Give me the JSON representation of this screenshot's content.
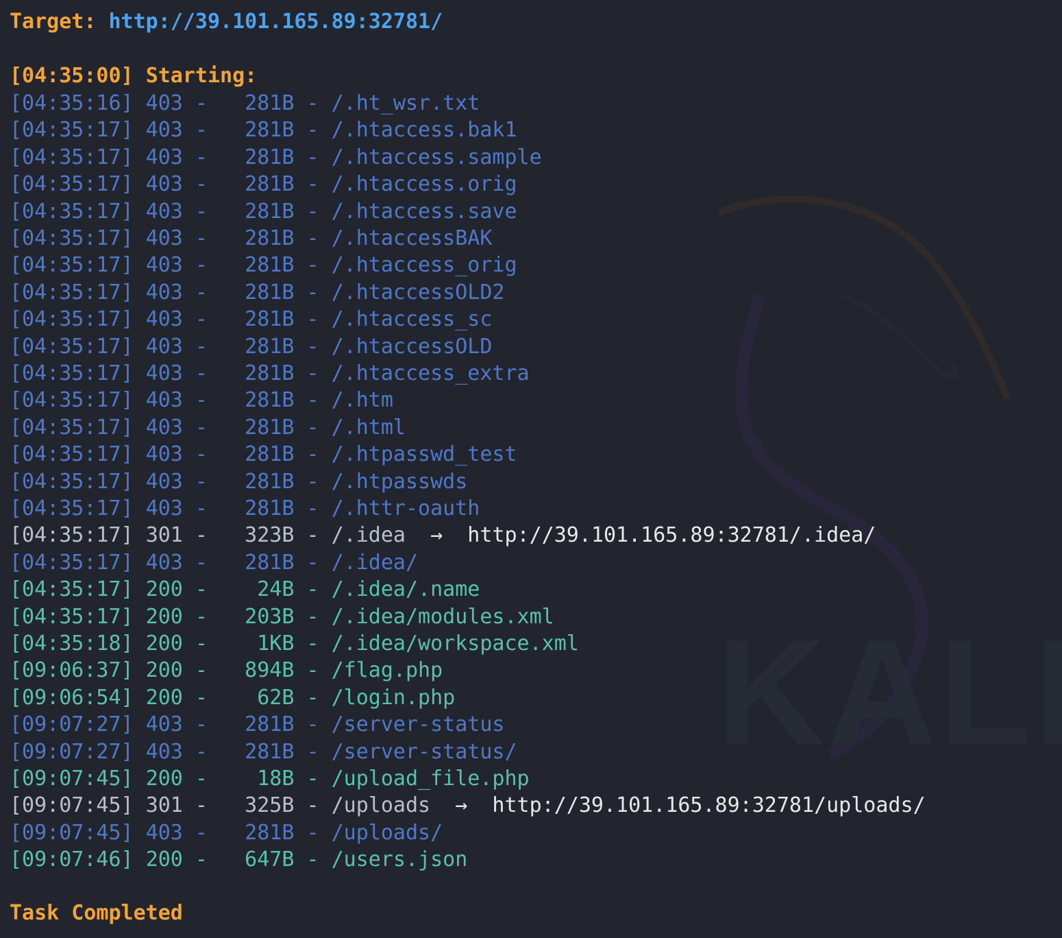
{
  "target": {
    "label": "Target:",
    "url": "http://39.101.165.89:32781/"
  },
  "start": {
    "time": "[04:35:00]",
    "label": "Starting:"
  },
  "rows": [
    {
      "time": "[04:35:16]",
      "status": "403",
      "size": "281B",
      "path": "/.ht_wsr.txt",
      "redirect": ""
    },
    {
      "time": "[04:35:17]",
      "status": "403",
      "size": "281B",
      "path": "/.htaccess.bak1",
      "redirect": ""
    },
    {
      "time": "[04:35:17]",
      "status": "403",
      "size": "281B",
      "path": "/.htaccess.sample",
      "redirect": ""
    },
    {
      "time": "[04:35:17]",
      "status": "403",
      "size": "281B",
      "path": "/.htaccess.orig",
      "redirect": ""
    },
    {
      "time": "[04:35:17]",
      "status": "403",
      "size": "281B",
      "path": "/.htaccess.save",
      "redirect": ""
    },
    {
      "time": "[04:35:17]",
      "status": "403",
      "size": "281B",
      "path": "/.htaccessBAK",
      "redirect": ""
    },
    {
      "time": "[04:35:17]",
      "status": "403",
      "size": "281B",
      "path": "/.htaccess_orig",
      "redirect": ""
    },
    {
      "time": "[04:35:17]",
      "status": "403",
      "size": "281B",
      "path": "/.htaccessOLD2",
      "redirect": ""
    },
    {
      "time": "[04:35:17]",
      "status": "403",
      "size": "281B",
      "path": "/.htaccess_sc",
      "redirect": ""
    },
    {
      "time": "[04:35:17]",
      "status": "403",
      "size": "281B",
      "path": "/.htaccessOLD",
      "redirect": ""
    },
    {
      "time": "[04:35:17]",
      "status": "403",
      "size": "281B",
      "path": "/.htaccess_extra",
      "redirect": ""
    },
    {
      "time": "[04:35:17]",
      "status": "403",
      "size": "281B",
      "path": "/.htm",
      "redirect": ""
    },
    {
      "time": "[04:35:17]",
      "status": "403",
      "size": "281B",
      "path": "/.html",
      "redirect": ""
    },
    {
      "time": "[04:35:17]",
      "status": "403",
      "size": "281B",
      "path": "/.htpasswd_test",
      "redirect": ""
    },
    {
      "time": "[04:35:17]",
      "status": "403",
      "size": "281B",
      "path": "/.htpasswds",
      "redirect": ""
    },
    {
      "time": "[04:35:17]",
      "status": "403",
      "size": "281B",
      "path": "/.httr-oauth",
      "redirect": ""
    },
    {
      "time": "[04:35:17]",
      "status": "301",
      "size": "323B",
      "path": "/.idea",
      "redirect": "http://39.101.165.89:32781/.idea/"
    },
    {
      "time": "[04:35:17]",
      "status": "403",
      "size": "281B",
      "path": "/.idea/",
      "redirect": ""
    },
    {
      "time": "[04:35:17]",
      "status": "200",
      "size": "24B",
      "path": "/.idea/.name",
      "redirect": ""
    },
    {
      "time": "[04:35:17]",
      "status": "200",
      "size": "203B",
      "path": "/.idea/modules.xml",
      "redirect": ""
    },
    {
      "time": "[04:35:18]",
      "status": "200",
      "size": "1KB",
      "path": "/.idea/workspace.xml",
      "redirect": ""
    },
    {
      "time": "[09:06:37]",
      "status": "200",
      "size": "894B",
      "path": "/flag.php",
      "redirect": ""
    },
    {
      "time": "[09:06:54]",
      "status": "200",
      "size": "62B",
      "path": "/login.php",
      "redirect": ""
    },
    {
      "time": "[09:07:27]",
      "status": "403",
      "size": "281B",
      "path": "/server-status",
      "redirect": ""
    },
    {
      "time": "[09:07:27]",
      "status": "403",
      "size": "281B",
      "path": "/server-status/",
      "redirect": ""
    },
    {
      "time": "[09:07:45]",
      "status": "200",
      "size": "18B",
      "path": "/upload_file.php",
      "redirect": ""
    },
    {
      "time": "[09:07:45]",
      "status": "301",
      "size": "325B",
      "path": "/uploads",
      "redirect": "http://39.101.165.89:32781/uploads/"
    },
    {
      "time": "[09:07:45]",
      "status": "403",
      "size": "281B",
      "path": "/uploads/",
      "redirect": ""
    },
    {
      "time": "[09:07:46]",
      "status": "200",
      "size": "647B",
      "path": "/users.json",
      "redirect": ""
    }
  ],
  "arrow": "→",
  "completed": "Task Completed",
  "watermark": "KALI",
  "colors": {
    "background": "#23252e",
    "orange": "#f2a33a",
    "url_blue": "#4ca3f0",
    "status_403": "#4f78c8",
    "status_200": "#58c2a8",
    "status_301": "#b9c0cc"
  }
}
